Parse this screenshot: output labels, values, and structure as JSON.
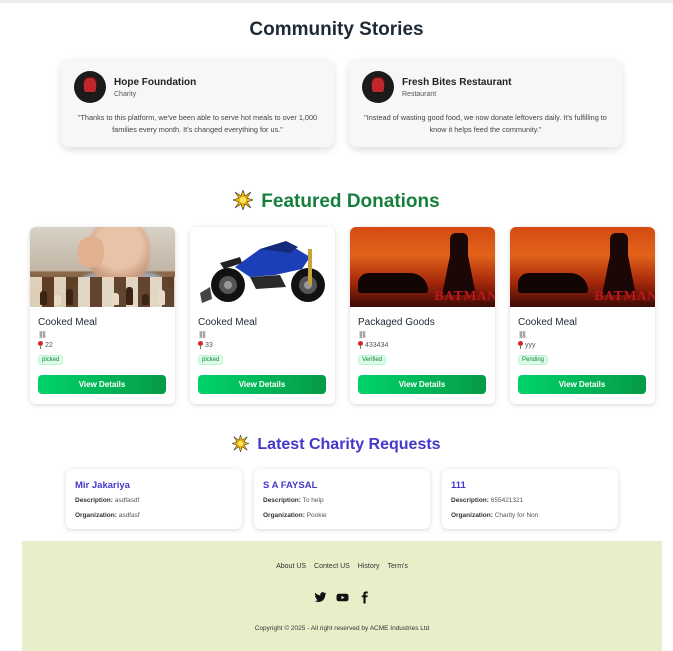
{
  "community": {
    "title": "Community Stories",
    "stories": [
      {
        "name": "Hope Foundation",
        "role": "Charity",
        "quote": "\"Thanks to this platform, we've been able to serve hot meals to over 1,000 families every month. It's changed everything for us.\""
      },
      {
        "name": "Fresh Bites Restaurant",
        "role": "Restaurant",
        "quote": "\"Instead of wasting good food, we now donate leftovers daily. It's fulfilling to know it helps feed the community.\""
      }
    ]
  },
  "featured": {
    "title": "Featured Donations",
    "icon": "sparkle-burst-icon",
    "button_label": "View Details",
    "cards": [
      {
        "title": "Cooked Meal",
        "location": "22",
        "status": "picked"
      },
      {
        "title": "Cooked Meal",
        "location": "33",
        "status": "picked"
      },
      {
        "title": "Packaged Goods",
        "location": "433434",
        "status": "Verified"
      },
      {
        "title": "Cooked Meal",
        "location": "yyy",
        "status": "Pending"
      }
    ]
  },
  "requests": {
    "title": "Latest Charity Requests",
    "description_label": "Description:",
    "organization_label": "Organization:",
    "items": [
      {
        "name": "Mir Jakariya",
        "description": "asdfasdf",
        "organization": "asdfasf"
      },
      {
        "name": "S A FAYSAL",
        "description": "To help",
        "organization": "Pookie"
      },
      {
        "name": "111",
        "description": "655421321",
        "organization": "Charity for Non"
      }
    ]
  },
  "footer": {
    "links": [
      "About US",
      "Contect US",
      "History",
      "Term's"
    ],
    "social": [
      "twitter-icon",
      "youtube-icon",
      "facebook-icon"
    ],
    "copyright": "Copyright © 2025 - All right reserved by ACME Industries Ltd"
  },
  "image_text": {
    "batman_logo": "BATMAN"
  },
  "colors": {
    "accent_green": "#15803d",
    "button_green": "#00d26a",
    "request_blue": "#4338ca",
    "footer_bg": "#e7efc8"
  }
}
